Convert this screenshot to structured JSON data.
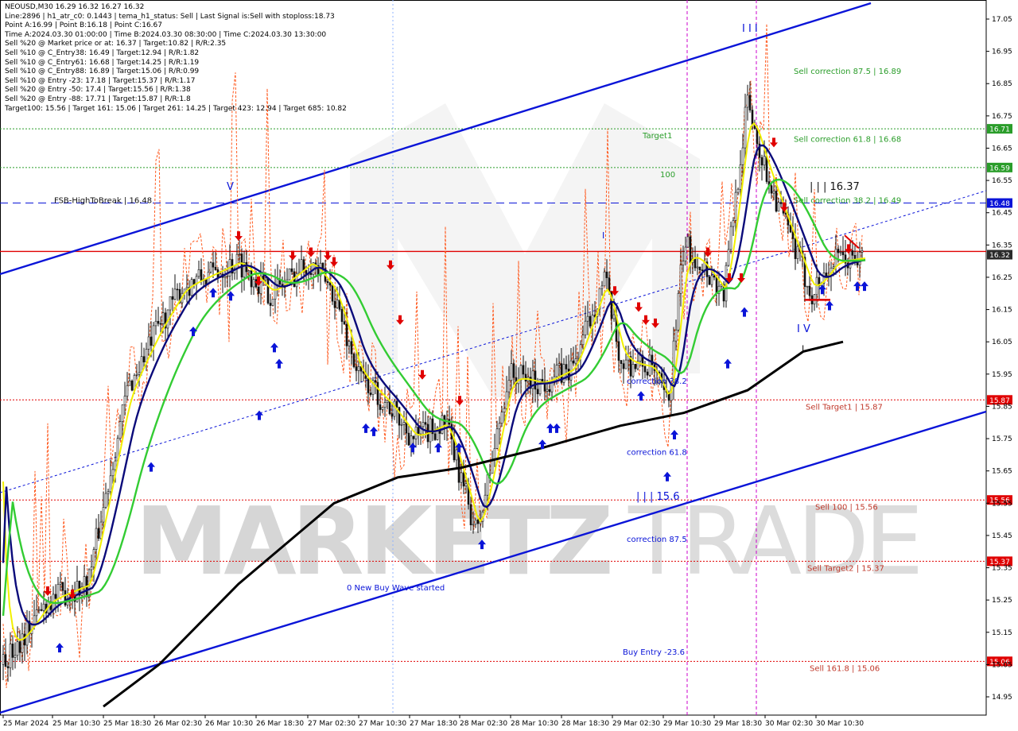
{
  "header": {
    "symbol_line": "NEOUSD,M30  16.29 16.32 16.27 16.32",
    "info_lines": [
      "Line:2896 | h1_atr_c0: 0.1443 | tema_h1_status: Sell | Last Signal is:Sell with stoploss:18.73",
      "Point A:16.99 | Point B:16.18 | Point C:16.67",
      "Time A:2024.03.30 01:00:00 | Time B:2024.03.30 08:30:00 | Time C:2024.03.30 13:30:00",
      "Sell %20 @ Market price or at: 16.37 | Target:10.82 | R/R:2.35",
      "Sell %10 @ C_Entry38: 16.49 | Target:12.94 | R/R:1.82",
      "Sell %10 @ C_Entry61: 16.68 | Target:14.25 | R/R:1.19",
      "Sell %10 @ C_Entry88: 16.89 | Target:15.06 | R/R:0.99",
      "Sell %10 @ Entry -23: 17.18 | Target:15.37 | R/R:1.17",
      "Sell %20 @ Entry -50: 17.4 | Target:15.56 | R/R:1.38",
      "Sell %20 @ Entry -88: 17.71 | Target:15.87 | R/R:1.8",
      "Target100: 15.56 | Target 161: 15.06 | Target 261: 14.25 | Target 423: 12.94 | Target 685: 10.82"
    ]
  },
  "watermark": {
    "text_left": "MARKETZ",
    "text_right": "TRADE"
  },
  "colors": {
    "background": "#ffffff",
    "channel": "#0a14d8",
    "resistance": "#e00000",
    "target_green": "#2a9d2a",
    "sell_red": "#c0392b",
    "candle": "#111111",
    "sma_black": "#000000",
    "ma_green": "#33cc33",
    "ma_yellow": "#f2f000",
    "ma_navy": "#0a0a7a",
    "envelope_orange": "#ff5a1f",
    "session_magenta": "#cc00cc",
    "current_price_bg": "#2b2b2b"
  },
  "chart_data": {
    "type": "candlestick",
    "symbol": "NEOUSD",
    "timeframe": "M30",
    "ylim": [
      14.92,
      17.08
    ],
    "y_ticks": [
      "17.05",
      "16.95",
      "16.85",
      "16.75",
      "16.65",
      "16.55",
      "16.45",
      "16.35",
      "16.25",
      "16.15",
      "16.05",
      "15.95",
      "15.85",
      "15.75",
      "15.65",
      "15.55",
      "15.45",
      "15.35",
      "15.25",
      "15.15",
      "15.05",
      "14.95"
    ],
    "x_labels": [
      "25 Mar 2024",
      "25 Mar 10:30",
      "25 Mar 18:30",
      "26 Mar 02:30",
      "26 Mar 10:30",
      "26 Mar 18:30",
      "27 Mar 02:30",
      "27 Mar 10:30",
      "27 Mar 18:30",
      "28 Mar 02:30",
      "28 Mar 10:30",
      "28 Mar 18:30",
      "29 Mar 02:30",
      "29 Mar 10:30",
      "29 Mar 18:30",
      "30 Mar 02:30",
      "30 Mar 10:30"
    ],
    "current_price": "16.32",
    "levels": [
      {
        "price": 16.71,
        "tag": "16.71",
        "color": "green",
        "style": "dotted"
      },
      {
        "price": 16.59,
        "tag": "16.59",
        "color": "green",
        "style": "dotted"
      },
      {
        "price": 16.48,
        "tag": "16.48",
        "color": "blue",
        "style": "dashed"
      },
      {
        "price": 16.33,
        "tag": "",
        "color": "red",
        "style": "solid"
      },
      {
        "price": 15.87,
        "tag": "15.87",
        "color": "red",
        "style": "dotted"
      },
      {
        "price": 15.56,
        "tag": "15.56",
        "color": "red",
        "style": "dotted"
      },
      {
        "price": 15.37,
        "tag": "15.37",
        "color": "red",
        "style": "dotted"
      },
      {
        "price": 15.06,
        "tag": "15.06",
        "color": "red",
        "style": "dotted"
      }
    ],
    "annotations": [
      {
        "text": "Sell correction 87.5 | 16.89",
        "price": 16.89,
        "color": "green"
      },
      {
        "text": "Sell correction 61.8 | 16.68",
        "price": 16.68,
        "color": "green"
      },
      {
        "text": "Sell correction 38.2 | 16.49",
        "price": 16.49,
        "color": "green"
      },
      {
        "text": "Target1",
        "price": 16.69,
        "color": "green"
      },
      {
        "text": "100",
        "price": 16.57,
        "color": "green"
      },
      {
        "text": "FSB-HighToBreak  | 16.48",
        "price": 16.49,
        "color": "black"
      },
      {
        "text": "Sell Target1 | 15.87",
        "price": 15.85,
        "color": "red"
      },
      {
        "text": "Sell 100 | 15.56",
        "price": 15.54,
        "color": "red"
      },
      {
        "text": "Sell Target2 | 15.37",
        "price": 15.35,
        "color": "red"
      },
      {
        "text": "Sell 161.8 | 15.06",
        "price": 15.04,
        "color": "red"
      },
      {
        "text": "correction 38.2",
        "price": 15.93,
        "color": "blue"
      },
      {
        "text": "correction 61.8",
        "price": 15.71,
        "color": "blue"
      },
      {
        "text": "correction 87.5",
        "price": 15.44,
        "color": "blue"
      },
      {
        "text": "| | | 15.6",
        "price": 15.57,
        "color": "blue"
      },
      {
        "text": "0 New Buy Wave started",
        "price": 15.29,
        "color": "blue"
      },
      {
        "text": "Buy Entry -23.6",
        "price": 15.09,
        "color": "blue"
      },
      {
        "text": "| | | 16.37",
        "price": 16.53,
        "color": "black"
      },
      {
        "text": "I V",
        "price": 16.09,
        "color": "blue"
      },
      {
        "text": "I",
        "price": 16.03,
        "color": "black"
      },
      {
        "text": "I I I",
        "price": 17.02,
        "color": "blue"
      },
      {
        "text": "V",
        "price": 16.53,
        "color": "blue"
      },
      {
        "text": "I",
        "price": 16.38,
        "color": "blue"
      }
    ],
    "grid": false
  }
}
